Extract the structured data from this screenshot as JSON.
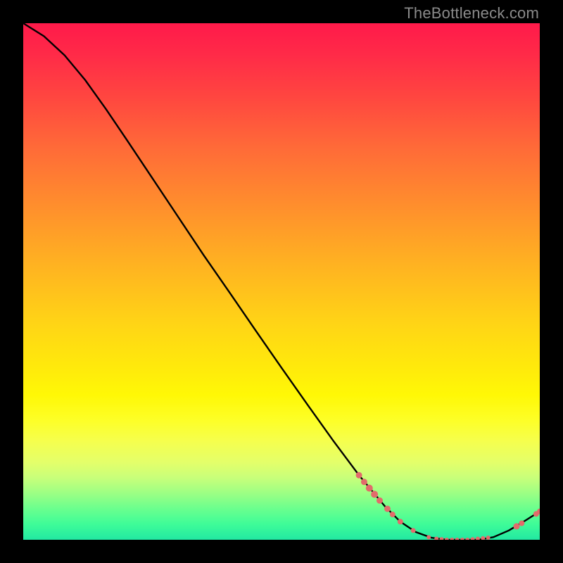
{
  "watermark": "TheBottleneck.com",
  "colors": {
    "marker": "#e26b6b",
    "curve": "#000000",
    "background": "#000000"
  },
  "chart_data": {
    "type": "line",
    "title": "",
    "xlabel": "",
    "ylabel": "",
    "xlim": [
      0,
      100
    ],
    "ylim": [
      0,
      100
    ],
    "grid": false,
    "series": [
      {
        "name": "bottleneck-curve",
        "x": [
          0,
          4,
          8,
          12,
          16,
          20,
          25,
          30,
          35,
          40,
          45,
          50,
          55,
          60,
          65,
          70,
          73,
          76,
          79,
          82,
          85,
          88,
          91,
          94,
          97,
          100
        ],
        "y": [
          100,
          97.5,
          93.8,
          89.0,
          83.4,
          77.5,
          70.0,
          62.5,
          55.0,
          47.8,
          40.5,
          33.3,
          26.2,
          19.2,
          12.5,
          6.5,
          3.5,
          1.5,
          0.4,
          0.0,
          0.0,
          0.0,
          0.5,
          1.8,
          3.6,
          5.5
        ]
      }
    ],
    "markers": [
      {
        "x": 65.0,
        "y": 12.5,
        "r": 4.5
      },
      {
        "x": 66.0,
        "y": 11.2,
        "r": 4.5
      },
      {
        "x": 67.0,
        "y": 10.0,
        "r": 5.0
      },
      {
        "x": 68.0,
        "y": 8.8,
        "r": 5.0
      },
      {
        "x": 69.0,
        "y": 7.6,
        "r": 4.5
      },
      {
        "x": 70.5,
        "y": 6.0,
        "r": 4.5
      },
      {
        "x": 71.5,
        "y": 4.9,
        "r": 4.0
      },
      {
        "x": 73.0,
        "y": 3.5,
        "r": 4.0
      },
      {
        "x": 75.5,
        "y": 1.8,
        "r": 3.5
      },
      {
        "x": 78.5,
        "y": 0.5,
        "r": 3.0
      },
      {
        "x": 80.0,
        "y": 0.2,
        "r": 3.0
      },
      {
        "x": 81.0,
        "y": 0.1,
        "r": 3.0
      },
      {
        "x": 82.0,
        "y": 0.0,
        "r": 3.0
      },
      {
        "x": 83.0,
        "y": 0.0,
        "r": 3.0
      },
      {
        "x": 84.0,
        "y": 0.0,
        "r": 3.0
      },
      {
        "x": 85.0,
        "y": 0.0,
        "r": 3.0
      },
      {
        "x": 86.0,
        "y": 0.0,
        "r": 3.0
      },
      {
        "x": 87.0,
        "y": 0.1,
        "r": 3.0
      },
      {
        "x": 88.0,
        "y": 0.2,
        "r": 3.0
      },
      {
        "x": 89.0,
        "y": 0.3,
        "r": 3.0
      },
      {
        "x": 90.0,
        "y": 0.4,
        "r": 3.0
      },
      {
        "x": 95.5,
        "y": 2.6,
        "r": 4.5
      },
      {
        "x": 96.5,
        "y": 3.2,
        "r": 4.0
      },
      {
        "x": 99.3,
        "y": 5.0,
        "r": 4.0
      },
      {
        "x": 100.0,
        "y": 5.5,
        "r": 4.0
      }
    ]
  }
}
